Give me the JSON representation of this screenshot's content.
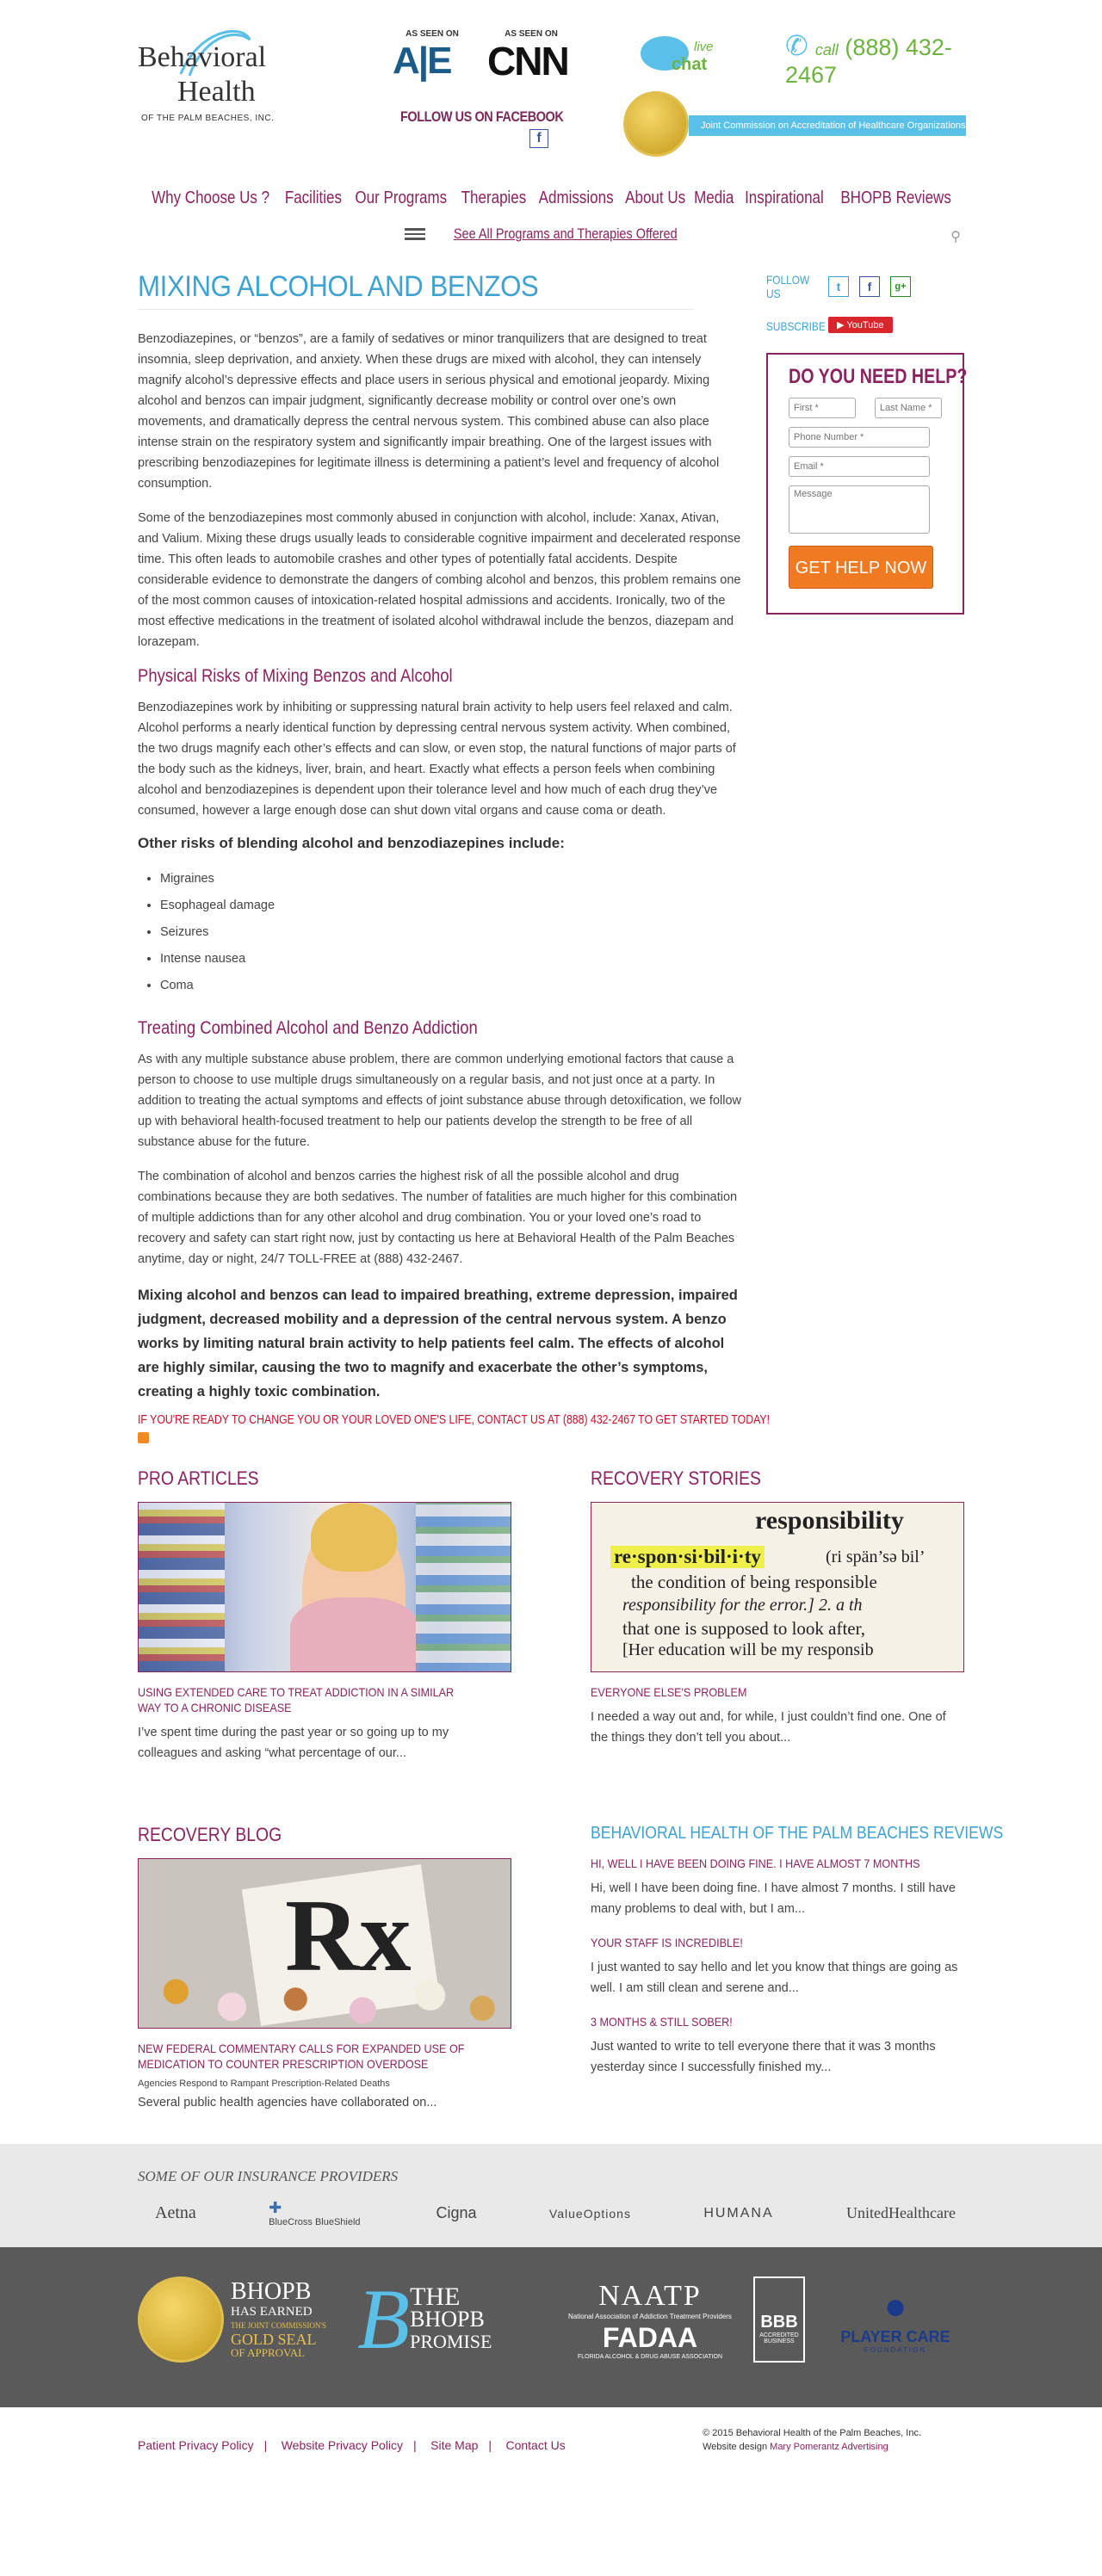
{
  "header": {
    "logo_line1": "Behavioral",
    "logo_line2": "Health",
    "logo_line3": "OF THE PALM BEACHES, INC.",
    "as_seen_on": "AS SEEN ON",
    "ae_logo": "A|E",
    "cnn_logo": "CNN",
    "follow_facebook": "FOLLOW US ON FACEBOOK",
    "fb_icon": "f",
    "chat_live": "live",
    "chat_label": "chat",
    "call_label": "call",
    "phone": "(888) 432-2467",
    "joint_commission": "Joint Commission on Accreditation of Healthcare Organizations"
  },
  "nav": {
    "items": [
      "Why Choose Us ?",
      "Facilities",
      "Our Programs",
      "Therapies",
      "Admissions",
      "About Us",
      "Media",
      "Inspirational",
      "BHOPB Reviews"
    ],
    "programs_link": "See All Programs and Therapies Offered",
    "search_icon": "⚲"
  },
  "article": {
    "title": "MIXING ALCOHOL AND BENZOS",
    "p1": "Benzodiazepines, or “benzos”, are a family of sedatives or minor tranquilizers that are designed to treat insomnia, sleep deprivation, and anxiety. When these drugs are mixed with alcohol, they can intensely magnify alcohol’s depressive effects and place users in serious physical and emotional jeopardy. Mixing alcohol and benzos can impair judgment, significantly decrease mobility or control over one’s own movements, and dramatically depress the central nervous system. This combined abuse can also place intense strain on the respiratory system and significantly impair breathing. One of the largest issues with prescribing benzodiazepines for legitimate illness is determining a patient’s level and frequency of alcohol consumption.",
    "p2": "Some of the benzodiazepines most commonly abused in conjunction with alcohol, include: Xanax, Ativan, and Valium. Mixing these drugs usually leads to considerable cognitive impairment and decelerated response time. This often leads to automobile crashes and other types of potentially fatal accidents. Despite considerable evidence to demonstrate the dangers of combing alcohol and benzos, this problem remains one of the most common causes of intoxication-related hospital admissions and accidents. Ironically, two of the most effective medications in the treatment of isolated alcohol withdrawal include the benzos, diazepam and lorazepam.",
    "h2a": "Physical Risks of Mixing Benzos and Alcohol",
    "p3": "Benzodiazepines work by inhibiting or suppressing natural brain activity to help users feel relaxed and calm. Alcohol performs a nearly identical function by depressing central nervous system activity. When combined, the two drugs magnify each other’s effects and can slow, or even stop, the natural functions of major parts of the body such as the kidneys, liver, brain, and heart. Exactly what effects a person feels when combining alcohol and benzodiazepines is dependent upon their tolerance level and how much of each drug they’ve consumed, however a large enough dose can shut down vital organs and cause coma or death.",
    "h3": "Other risks of blending alcohol and benzodiazepines include:",
    "risks": [
      "Migraines",
      "Esophageal damage",
      "Seizures",
      "Intense nausea",
      "Coma"
    ],
    "h2b": "Treating Combined Alcohol and Benzo Addiction",
    "p4": "As with any multiple substance abuse problem, there are common underlying emotional factors that cause a person to choose to use multiple drugs simultaneously on a regular basis, and not just once at a party. In addition to treating the actual symptoms and effects of joint substance abuse through detoxification, we follow up with behavioral health-focused treatment to help our patients develop the strength to be free of all substance abuse for the future.",
    "p5": "The combination of alcohol and benzos carries the highest risk of all the possible alcohol and drug combinations because they are both sedatives. The number of fatalities are much higher for this combination of multiple addictions than for any other alcohol and drug combination. You or your loved one’s road to recovery and safety can start right now, just by contacting us here at Behavioral Health of the Palm Beaches anytime, day or night, 24/7 TOLL-FREE at (888) 432-2467.",
    "bold": "Mixing alcohol and benzos can lead to impaired breathing, extreme depression, impaired judgment, decreased mobility and a depression of the central nervous system. A benzo works by limiting natural brain activity to help patients feel calm. The effects of alcohol are highly similar, causing the two to magnify and exacerbate the other’s symptoms, creating a highly toxic combination.",
    "cta": "IF YOU'RE READY TO CHANGE YOU OR YOUR LOVED ONE'S LIFE, CONTACT US AT (888) 432-2467 TO GET STARTED TODAY!"
  },
  "sidebar": {
    "follow": "FOLLOW US",
    "twitter_icon": "t",
    "facebook_icon": "f",
    "google_icon": "g+",
    "subscribe": "SUBSCRIBE",
    "youtube": "YouTube",
    "help_title": "DO YOU NEED HELP?",
    "first_ph": "First *",
    "last_ph": "Last Name *",
    "phone_ph": "Phone Number *",
    "email_ph": "Email *",
    "message_ph": "Message",
    "button": "GET HELP NOW"
  },
  "pro_articles": {
    "heading": "PRO ARTICLES",
    "title": "USING EXTENDED CARE TO TREAT ADDICTION IN A SIMILAR WAY TO A CHRONIC DISEASE",
    "excerpt": "I’ve spent time during the past year or so going up to my colleagues and asking “what percentage of our..."
  },
  "recovery_stories": {
    "heading": "RECOVERY STORIES",
    "img_word": "responsibility",
    "img_line1": "re·spon·si·bil·i·ty",
    "img_pron": "(ri spän’sə bil’",
    "img_line2": "the condition of being responsible",
    "img_line3": "responsibility for the error.]  2. a th",
    "img_line4": "that one is supposed to look after,",
    "img_line5": "[Her education will be my responsib",
    "title": "EVERYONE ELSE'S PROBLEM",
    "excerpt": "I needed a way out and, for while, I just couldn’t find one. One of the things they don’t tell you about..."
  },
  "recovery_blog": {
    "heading": "RECOVERY BLOG",
    "rx": "Rx",
    "title": "NEW FEDERAL COMMENTARY CALLS FOR EXPANDED USE OF MEDICATION TO COUNTER PRESCRIPTION OVERDOSE",
    "sub": "Agencies Respond to Rampant Prescription-Related Deaths",
    "excerpt": "Several public health agencies have collaborated on..."
  },
  "reviews": {
    "heading": "BEHAVIORAL HEALTH OF THE PALM BEACHES REVIEWS",
    "items": [
      {
        "title": "HI, WELL I HAVE BEEN DOING FINE. I HAVE ALMOST 7 MONTHS",
        "text": "Hi, well I have been doing fine. I have almost 7 months. I still have many problems to deal with, but I am..."
      },
      {
        "title": "YOUR STAFF IS INCREDIBLE!",
        "text": "I just wanted to say hello and let you know that things are going as well. I am still clean and serene and..."
      },
      {
        "title": "3 MONTHS & STILL SOBER!",
        "text": "Just wanted to write to tell everyone there that it was 3 months yesterday since I successfully finished my..."
      }
    ]
  },
  "insurance": {
    "label": "SOME OF OUR INSURANCE PROVIDERS",
    "logos": [
      "Aetna",
      "BlueCross BlueShield",
      "Cigna",
      "ValueOptions",
      "HUMANA",
      "UnitedHealthcare"
    ]
  },
  "awards": {
    "bhopb": "BHOPB",
    "bhopb_sub1": "HAS EARNED",
    "bhopb_sub2": "THE JOINT COMMISSION'S",
    "bhopb_sub3": "GOLD SEAL",
    "bhopb_sub4": "OF APPROVAL",
    "promise1": "THE",
    "promise2": "BHOPB",
    "promise3": "PROMISE",
    "naatp": "NAATP",
    "naatp_sub": "National Association of Addiction Treatment Providers",
    "fadaa": "FADAA",
    "fadaa_sub": "FLORIDA ALCOHOL & DRUG ABUSE ASSOCIATION",
    "bbb": "BBB",
    "bbb_sub": "ACCREDITED BUSINESS",
    "player": "PLAYER CARE",
    "player_sub": "FOUNDATION"
  },
  "footer": {
    "links": [
      "Patient Privacy Policy",
      "Website Privacy Policy",
      "Site Map",
      "Contact Us"
    ],
    "copyright": "© 2015 Behavioral Health of the Palm Beaches, Inc.",
    "design_prefix": "Website design",
    "designer": "Mary Pomerantz Advertising"
  },
  "colors": {
    "brand_plum": "#8a2360",
    "accent_blue": "#3fa2d0",
    "cta_orange": "#ef7a22",
    "phone_green": "#6cb33f"
  }
}
